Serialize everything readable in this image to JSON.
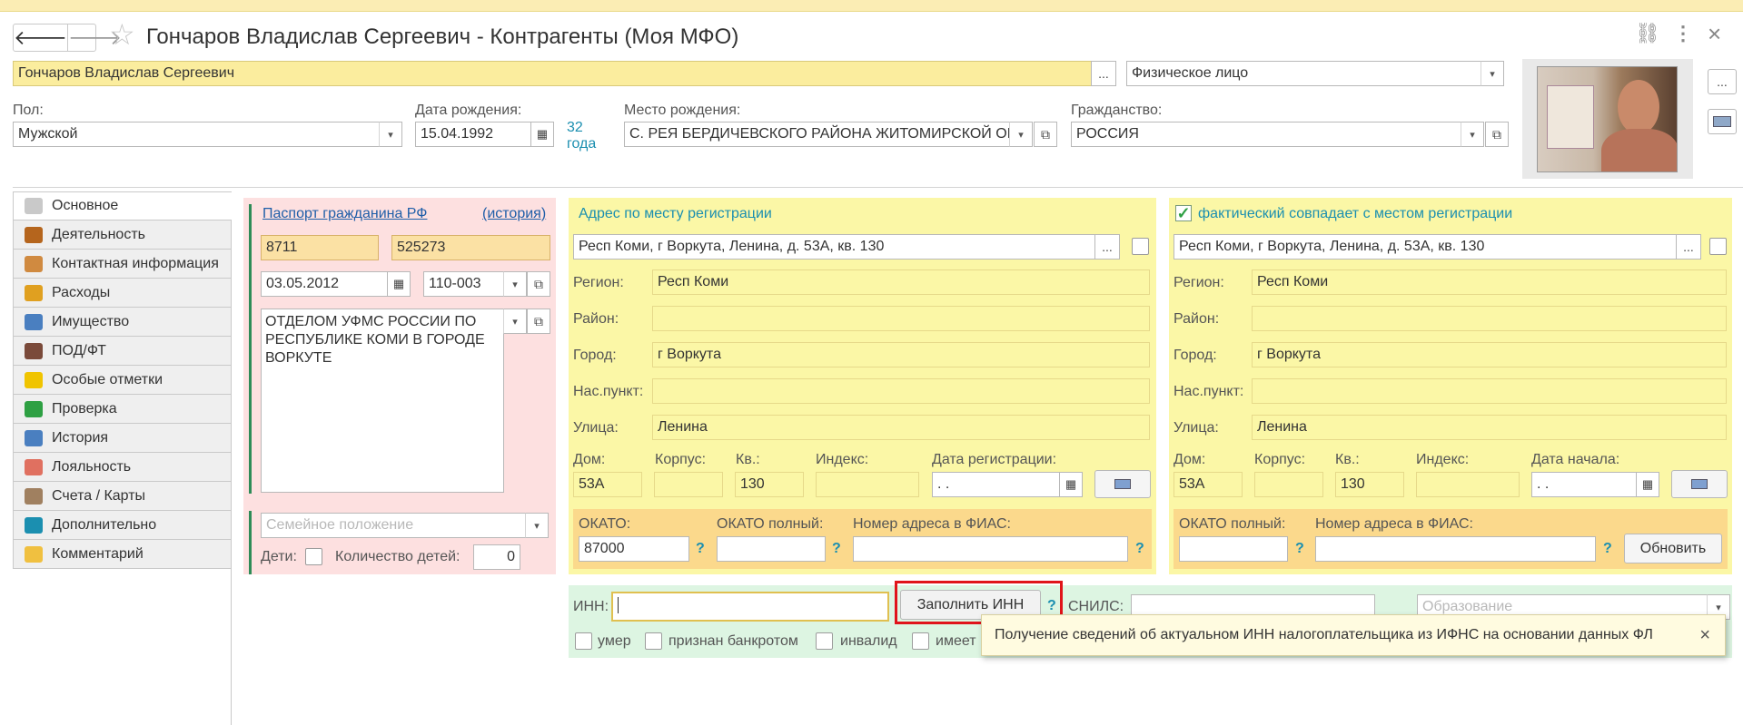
{
  "window": {
    "title": "Гончаров Владислав Сергеевич - Контрагенты (Моя МФО)",
    "back": "🡐",
    "forward": "🡒",
    "star": "☆",
    "link_icon": "⛓",
    "more_icon": "⋮",
    "close_icon": "×"
  },
  "header": {
    "name_value": "Гончаров Владислав Сергеевич",
    "type_value": "Физическое лицо",
    "sex_label": "Пол:",
    "sex_value": "Мужской",
    "dob_label": "Дата рождения:",
    "dob_value": "15.04.1992",
    "age_line1": "32",
    "age_line2": "года",
    "birthplace_label": "Место рождения:",
    "birthplace_value": "С. РЕЯ БЕРДИЧЕВСКОГО РАЙОНА ЖИТОМИРСКОЙ ОБЛ",
    "citizenship_label": "Гражданство:",
    "citizenship_value": "РОССИЯ",
    "ellipsis": "...",
    "dropdown": "▾",
    "open": "⧉"
  },
  "sidebar": {
    "items": [
      {
        "label": "Основное",
        "color": "#c9c9c9"
      },
      {
        "label": "Деятельность",
        "color": "#b5651d"
      },
      {
        "label": "Контактная информация",
        "color": "#d08a40"
      },
      {
        "label": "Расходы",
        "color": "#e0a020"
      },
      {
        "label": "Имущество",
        "color": "#4a7fc0"
      },
      {
        "label": "ПОД/ФТ",
        "color": "#7a4a3a"
      },
      {
        "label": "Особые отметки",
        "color": "#f0c400"
      },
      {
        "label": "Проверка",
        "color": "#2ea043"
      },
      {
        "label": "История",
        "color": "#4a7fc0"
      },
      {
        "label": "Лояльность",
        "color": "#e07060"
      },
      {
        "label": "Счета / Карты",
        "color": "#a08060"
      },
      {
        "label": "Дополнительно",
        "color": "#1b8fb0"
      },
      {
        "label": "Комментарий",
        "color": "#f0c040"
      }
    ]
  },
  "passport": {
    "title": "Паспорт гражданина РФ",
    "history": "(история)",
    "series": "8711",
    "number": "525273",
    "issue_date": "03.05.2012",
    "dept_code": "110-003",
    "issued_by": "ОТДЕЛОМ УФМС РОССИИ ПО РЕСПУБЛИКЕ КОМИ В ГОРОДЕ ВОРКУТЕ",
    "marital_placeholder": "Семейное положение",
    "children_label": "Дети:",
    "children_count_label": "Количество детей:",
    "children_count": "0"
  },
  "reg_address": {
    "title": "Адрес по месту регистрации",
    "full": "Респ Коми, г Воркута, Ленина, д. 53А, кв. 130",
    "region_label": "Регион:",
    "region": "Респ Коми",
    "district_label": "Район:",
    "city_label": "Город:",
    "city": "г Воркута",
    "settlement_label": "Нас.пункт:",
    "street_label": "Улица:",
    "street": "Ленина",
    "house_label": "Дом:",
    "house": "53А",
    "building_label": "Корпус:",
    "flat_label": "Кв.:",
    "flat": "130",
    "index_label": "Индекс:",
    "reg_date_label": "Дата регистрации:",
    "reg_date": " .  .",
    "okato_label": "ОКАТО:",
    "okato": "87000",
    "okato_full_label": "ОКАТО полный:",
    "fias_label": "Номер адреса в ФИАС:",
    "q": "?"
  },
  "fact_address": {
    "title": "фактический совпадает с местом регистрации",
    "full": "Респ Коми, г Воркута, Ленина, д. 53А, кв. 130",
    "region_label": "Регион:",
    "region": "Респ Коми",
    "district_label": "Район:",
    "city_label": "Город:",
    "city": "г Воркута",
    "settlement_label": "Нас.пункт:",
    "street_label": "Улица:",
    "street": "Ленина",
    "house_label": "Дом:",
    "house": "53А",
    "building_label": "Корпус:",
    "flat_label": "Кв.:",
    "flat": "130",
    "index_label": "Индекс:",
    "start_date_label": "Дата начала:",
    "start_date": " .  .",
    "okato_full_label": "ОКАТО полный:",
    "fias_label": "Номер адреса в ФИАС:",
    "refresh": "Обновить",
    "q": "?"
  },
  "bottom": {
    "inn_label": "ИНН:",
    "fill_inn": "Заполнить ИНН",
    "q": "?",
    "snils_label": "СНИЛС:",
    "education_placeholder": "Образование",
    "dead_label": "умер",
    "bankrupt_label": "признан банкротом",
    "invalid_label": "инвалид",
    "has_label": "имеет"
  },
  "tooltip": {
    "text": "Получение сведений об актуальном ИНН налогоплательщика из ИФНС  на основании данных ФЛ",
    "close": "×"
  }
}
